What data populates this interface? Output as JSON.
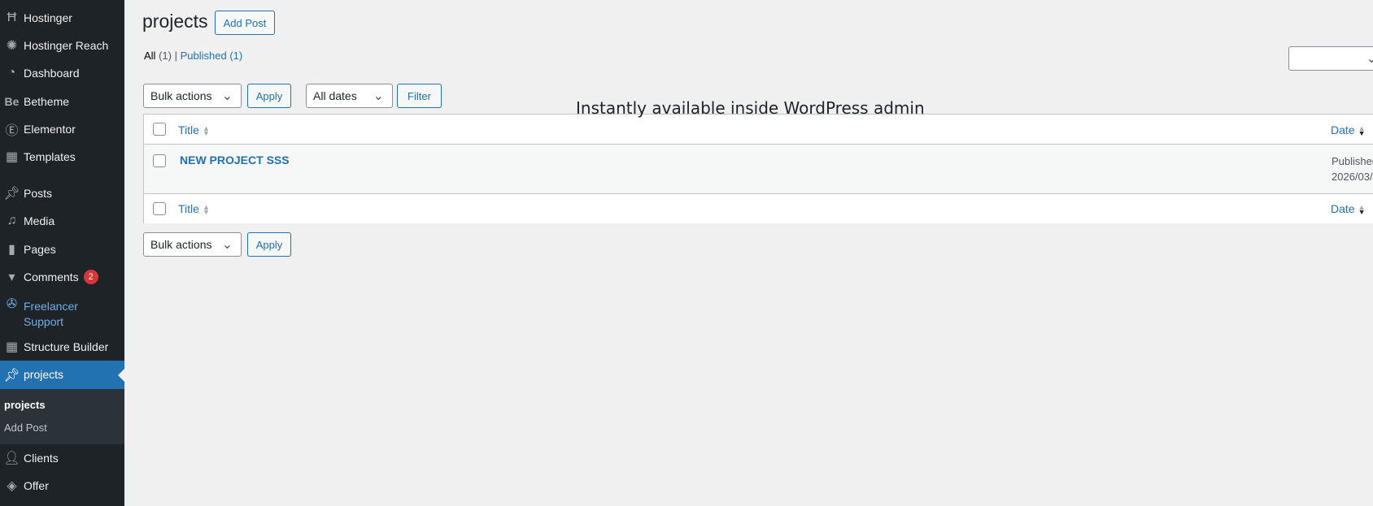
{
  "sidebar": {
    "items": [
      {
        "label": "Hostinger",
        "icon": "hostinger-icon"
      },
      {
        "label": "Hostinger Reach",
        "icon": "reach-icon"
      },
      {
        "label": "Dashboard",
        "icon": "dashboard-icon"
      },
      {
        "label": "Betheme",
        "icon": "betheme-icon"
      },
      {
        "label": "Elementor",
        "icon": "elementor-icon"
      },
      {
        "label": "Templates",
        "icon": "templates-icon"
      },
      {
        "label": "Posts",
        "icon": "pin-icon"
      },
      {
        "label": "Media",
        "icon": "media-icon"
      },
      {
        "label": "Pages",
        "icon": "pages-icon"
      },
      {
        "label": "Comments",
        "icon": "comment-icon",
        "badge": "2"
      },
      {
        "label": "Freelancer Support",
        "icon": "support-icon"
      },
      {
        "label": "Structure Builder",
        "icon": "structure-icon"
      },
      {
        "label": "projects",
        "icon": "pin-icon"
      },
      {
        "label": "Clients",
        "icon": "user-icon"
      },
      {
        "label": "Offer",
        "icon": "tag-icon"
      }
    ],
    "submenu": [
      "projects",
      "Add Post"
    ]
  },
  "header": {
    "title": "projects",
    "add_button": "Add Post"
  },
  "filters": {
    "all": "All",
    "all_count": "(1)",
    "sep": "|",
    "published": "Published",
    "published_count": "(1)"
  },
  "toolbar": {
    "bulk": "Bulk actions",
    "apply": "Apply",
    "dates": "All dates",
    "filter": "Filter"
  },
  "table": {
    "col_title": "Title",
    "col_date": "Date",
    "rows": [
      {
        "title": "NEW PROJECT SSS",
        "status": "Published",
        "date": "2026/03/"
      }
    ]
  },
  "overlay": "Instantly available inside WordPress admin",
  "colors": {
    "accent": "#2271b1",
    "sidebar": "#1d2327",
    "badge": "#d63638"
  }
}
